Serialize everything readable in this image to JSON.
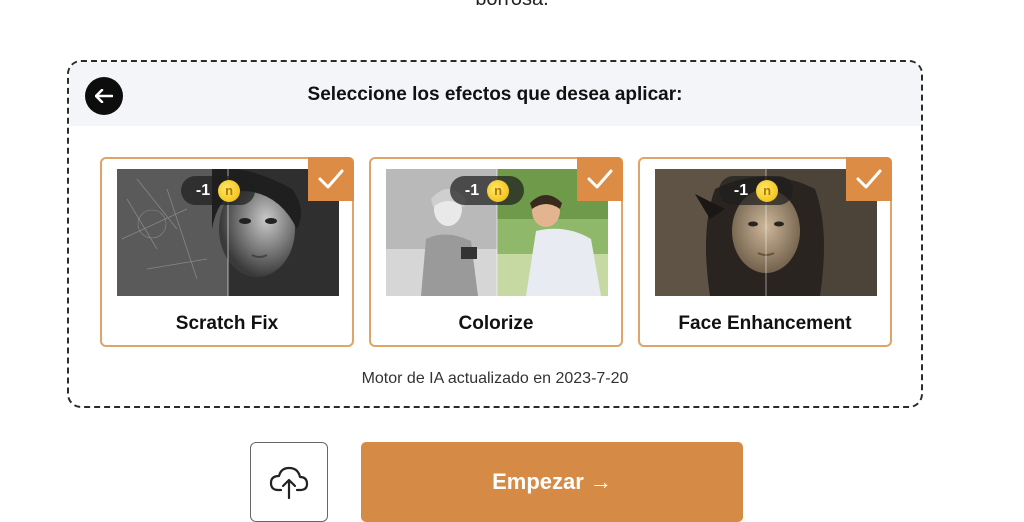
{
  "page": {
    "top_cut_text": "borrosa."
  },
  "panel": {
    "title": "Seleccione los efectos que desea aplicar:",
    "footnote": "Motor de IA actualizado en 2023-7-20"
  },
  "cards": [
    {
      "label": "Scratch Fix",
      "cost": "-1",
      "coin_letter": "n",
      "selected": true
    },
    {
      "label": "Colorize",
      "cost": "-1",
      "coin_letter": "n",
      "selected": true
    },
    {
      "label": "Face Enhancement",
      "cost": "-1",
      "coin_letter": "n",
      "selected": true
    }
  ],
  "actions": {
    "start_label": "Empezar →"
  },
  "icons": {
    "back": "arrow-left-icon",
    "check": "checkmark-icon",
    "coin": "coin-icon",
    "upload": "cloud-upload-icon"
  },
  "colors": {
    "accent": "#d58b45",
    "card_border": "#e0a368",
    "header_bg": "#f4f5f8"
  }
}
